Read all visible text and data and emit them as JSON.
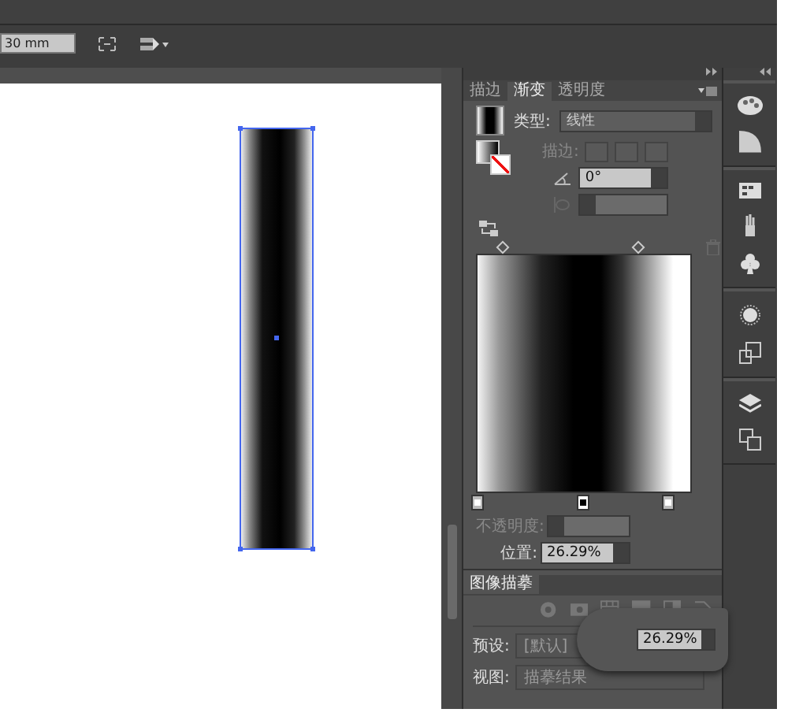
{
  "toolbar": {
    "width_field": "30 mm"
  },
  "gradient_panel": {
    "tabs": [
      {
        "label": "描边",
        "selected": false
      },
      {
        "label": "渐变",
        "selected": true
      },
      {
        "label": "透明度",
        "selected": false
      }
    ],
    "type_label": "类型:",
    "type_value": "线性",
    "stroke_label": "描边:",
    "angle_value": "0°",
    "stops": [
      {
        "color": "#ffffff",
        "selected": false
      },
      {
        "color": "#000000",
        "selected": true
      },
      {
        "color": "#ffffff",
        "selected": false
      }
    ],
    "opacity_label": "不透明度:",
    "location_label": "位置:",
    "location_value": "26.29%"
  },
  "image_trace_panel": {
    "tab": "图像描摹",
    "preset_label": "预设:",
    "preset_value": "[默认]",
    "view_label": "视图:",
    "view_value": "描摹结果"
  },
  "magnifier": {
    "value": "26.29%"
  }
}
